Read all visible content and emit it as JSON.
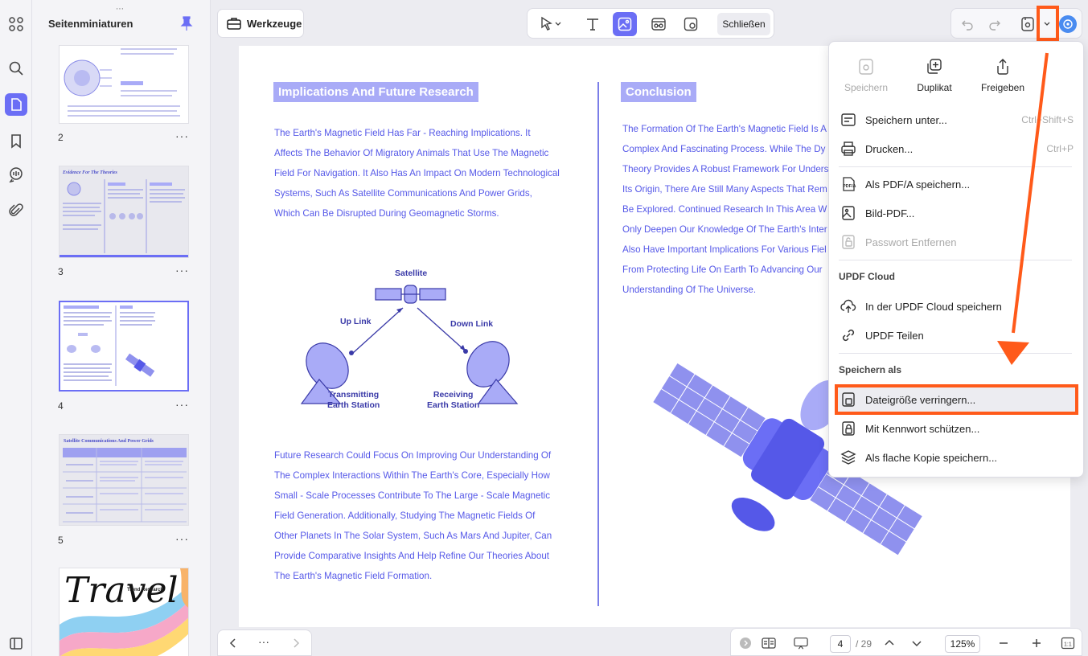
{
  "sidebar": {
    "title": "Seitenminiaturen",
    "pages": [
      {
        "number": "2"
      },
      {
        "number": "3",
        "heading": "Evidence For The Theories"
      },
      {
        "number": "4"
      },
      {
        "number": "5",
        "heading": "Satellite Communications And Power Grids"
      },
      {
        "number": "",
        "title": "Travel",
        "subtitle": "Trend Research"
      }
    ],
    "more": "···"
  },
  "toolbar": {
    "tools_label": "Werkzeuge",
    "close_label": "Schließen"
  },
  "document": {
    "left_heading": "Implications And Future Research",
    "left_para1": "The Earth's Magnetic Field Has Far - Reaching Implications. It Affects The Behavior Of Migratory Animals That Use The Magnetic Field For Navigation. It Also Has An Impact On Modern Technological Systems, Such As Satellite Communications And Power Grids, Which Can Be Disrupted During Geomagnetic Storms.",
    "diagram": {
      "satellite": "Satellite",
      "uplink": "Up Link",
      "downlink": "Down Link",
      "transmitting": "Transmitting\nEarth Station",
      "receiving": "Receiving\nEarth Station"
    },
    "left_para2": "Future Research Could Focus On Improving Our Understanding Of The Complex Interactions Within The Earth's Core, Especially How Small - Scale Processes Contribute To The Large - Scale Magnetic Field Generation. Additionally, Studying The Magnetic Fields Of Other Planets In The Solar System, Such As Mars And Jupiter, Can Provide Comparative Insights And Help Refine Our Theories About The Earth's Magnetic Field Formation.",
    "right_heading": "Conclusion",
    "right_para": "The Formation Of The Earth's Magnetic Field Is A Complex And Fascinating Process. While The Dy Theory Provides A Robust Framework For Unders Its Origin, There Are Still Many Aspects That Rem Be Explored. Continued Research In This Area W Only Deepen Our Knowledge Of The Earth's Inter Also Have Important Implications For Various Fiel From Protecting Life On Earth To Advancing Our Understanding Of The Universe."
  },
  "menu": {
    "top_actions": [
      {
        "label": "Speichern",
        "disabled": true
      },
      {
        "label": "Duplikat",
        "disabled": false
      },
      {
        "label": "Freigeben",
        "disabled": false
      }
    ],
    "save_as_label": "Speichern unter...",
    "save_as_shortcut": "Ctrl+Shift+S",
    "print_label": "Drucken...",
    "print_shortcut": "Ctrl+P",
    "pdfa_label": "Als PDF/A speichern...",
    "image_pdf_label": "Bild-PDF...",
    "remove_password_label": "Passwort Entfernen",
    "cloud_section": "UPDF Cloud",
    "cloud_save_label": "In der UPDF Cloud speichern",
    "share_label": "UPDF Teilen",
    "saveas_section": "Speichern als",
    "reduce_label": "Dateigröße verringern...",
    "protect_label": "Mit Kennwort schützen...",
    "flatten_label": "Als flache Kopie speichern..."
  },
  "bottom": {
    "current_page": "4",
    "total_pages": "/ 29",
    "zoom": "125%",
    "dots": "···"
  },
  "colors": {
    "accent": "#6b6ef5",
    "highlight": "#ff5a1a",
    "doc_text": "#5558e8"
  }
}
